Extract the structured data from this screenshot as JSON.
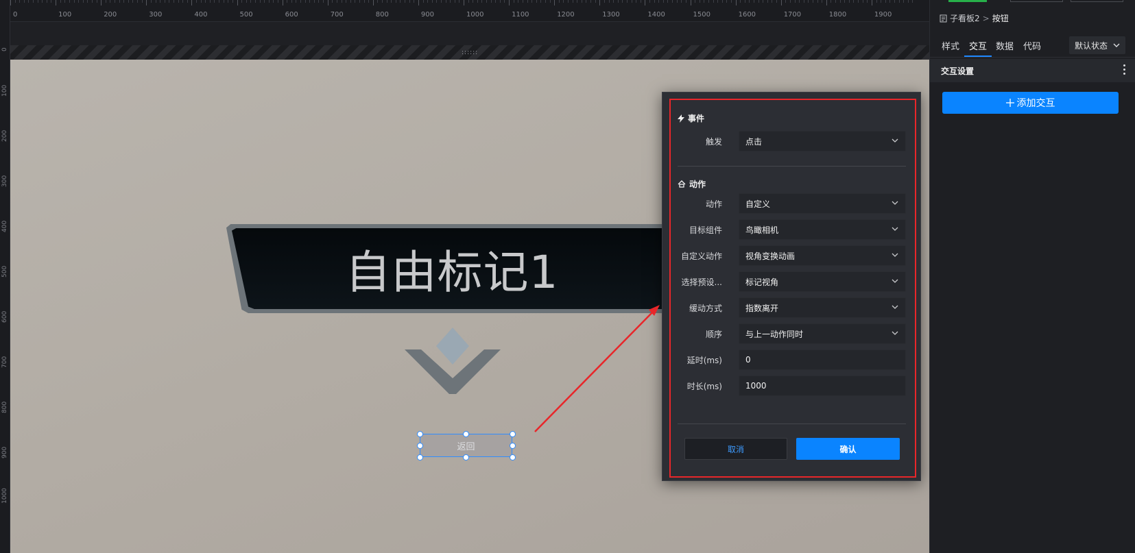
{
  "ruler": {
    "horizontal_labels": [
      "0",
      "100",
      "200",
      "300",
      "400",
      "500",
      "600",
      "700",
      "800",
      "900",
      "1000",
      "1100",
      "1200",
      "1300",
      "1400",
      "1500",
      "1600",
      "1700",
      "1800",
      "1900"
    ],
    "vertical_labels": [
      "0",
      "100",
      "200",
      "300",
      "400",
      "500",
      "600",
      "700",
      "800",
      "900",
      "1000"
    ]
  },
  "canvas": {
    "grip": "::::::",
    "marker_title": "自由标记1",
    "back_button_label": "返回"
  },
  "dialog": {
    "event_section": {
      "title": "事件",
      "trigger_label": "触发",
      "trigger_value": "点击"
    },
    "action_section": {
      "title": "动作",
      "rows": [
        {
          "label": "动作",
          "value": "自定义",
          "type": "select"
        },
        {
          "label": "目标组件",
          "value": "鸟瞰相机",
          "type": "select"
        },
        {
          "label": "自定义动作",
          "value": "视角变换动画",
          "type": "select"
        },
        {
          "label": "选择预设...",
          "value": "标记视角",
          "type": "select"
        },
        {
          "label": "缓动方式",
          "value": "指数离开",
          "type": "select"
        },
        {
          "label": "顺序",
          "value": "与上一动作同时",
          "type": "select"
        },
        {
          "label": "延时(ms)",
          "value": "0",
          "type": "input"
        },
        {
          "label": "时长(ms)",
          "value": "1000",
          "type": "input"
        }
      ]
    },
    "cancel_label": "取消",
    "confirm_label": "确认"
  },
  "right_panel": {
    "breadcrumb_parent": "子看板2",
    "breadcrumb_separator": ">",
    "breadcrumb_current": "按钮",
    "tabs": [
      "样式",
      "交互",
      "数据",
      "代码"
    ],
    "active_tab": "交互",
    "state_select": "默认状态",
    "interaction_title": "交互设置",
    "add_interaction_label": "添加交互"
  },
  "colors": {
    "accent": "#0a84ff",
    "highlight_frame": "#e8262a",
    "arrow": "#e8262a"
  }
}
